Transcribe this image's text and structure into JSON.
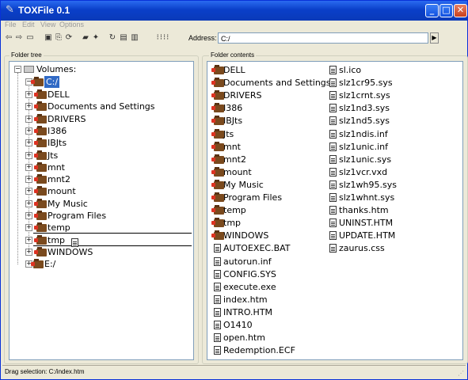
{
  "window": {
    "title": "TOXFile 0.1",
    "minimize": "_",
    "maximize": "□",
    "close": "✕"
  },
  "menu": [
    "File",
    "Edit",
    "View",
    "Options"
  ],
  "toolbar": {
    "address_label": "Address:",
    "address_value": "C:/",
    "go_glyph": "▶",
    "icons": [
      "back-icon",
      "forward-icon",
      "drive-icon",
      "save-icon",
      "copy-icon",
      "refresh-icon",
      "open-folder-icon",
      "tools-icon",
      "reload-icon",
      "document-icon",
      "delete-icon",
      "view-details-icon"
    ]
  },
  "folder_tree": {
    "title": "Folder tree",
    "root": "Volumes:",
    "selected": "C:/",
    "children": [
      "DELL",
      "Documents and Settings",
      "DRIVERS",
      "I386",
      "IBJts",
      "Jts",
      "mnt",
      "mnt2",
      "mount",
      "My Music",
      "Program Files",
      "temp",
      "tmp",
      "WINDOWS"
    ],
    "other_volume": "E:/"
  },
  "folder_contents": {
    "title": "Folder contents",
    "col1_folders": [
      "DELL",
      "Documents and Settings",
      "DRIVERS",
      "I386",
      "IBJts",
      "Jts",
      "mnt",
      "mnt2",
      "mount",
      "My Music",
      "Program Files",
      "temp",
      "tmp",
      "WINDOWS"
    ],
    "col1_files": [
      "AUTOEXEC.BAT",
      "autorun.inf",
      "CONFIG.SYS",
      "execute.exe",
      "index.htm",
      "INTRO.HTM",
      "O1410",
      "open.htm",
      "Redemption.ECF"
    ],
    "col2_files": [
      "sl.ico",
      "slz1cr95.sys",
      "slz1crnt.sys",
      "slz1nd3.sys",
      "slz1nd5.sys",
      "slz1ndis.inf",
      "slz1unic.inf",
      "slz1unic.sys",
      "slz1vcr.vxd",
      "slz1wh95.sys",
      "slz1whnt.sys",
      "thanks.htm",
      "UNINST.HTM",
      "UPDATE.HTM",
      "zaurus.css"
    ]
  },
  "status": {
    "text": "Drag selection: C:/index.htm"
  }
}
